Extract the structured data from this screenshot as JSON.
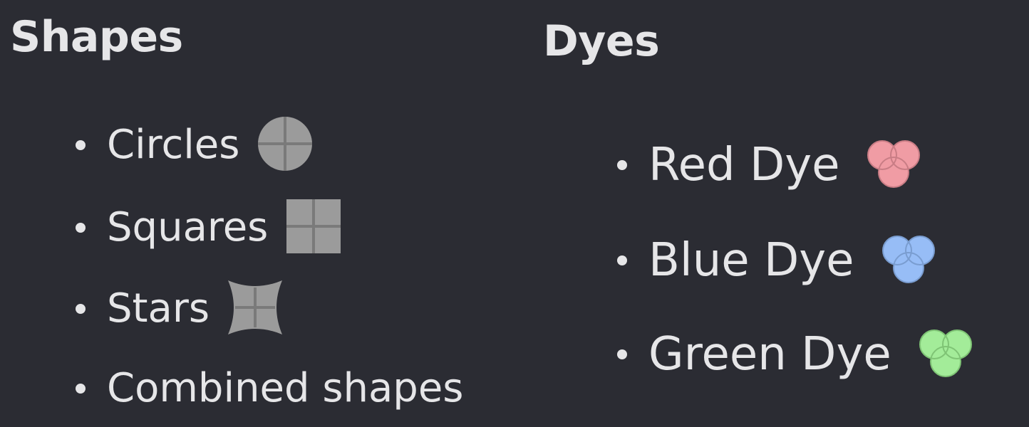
{
  "shapes": {
    "title": "Shapes",
    "items": [
      {
        "label": "Circles",
        "icon": "circle-icon"
      },
      {
        "label": "Squares",
        "icon": "square-icon"
      },
      {
        "label": "Stars",
        "icon": "star-icon"
      },
      {
        "label": "Combined shapes",
        "icon": ""
      }
    ]
  },
  "dyes": {
    "title": "Dyes",
    "items": [
      {
        "label": "Red Dye",
        "icon": "red-dye-icon",
        "color": "#f09ca4"
      },
      {
        "label": "Blue Dye",
        "icon": "blue-dye-icon",
        "color": "#97bdf6"
      },
      {
        "label": "Green Dye",
        "icon": "green-dye-icon",
        "color": "#a3ec99"
      }
    ]
  },
  "colors": {
    "background": "#2b2c33",
    "text": "#e6e6e8",
    "shape_icon": "#9b9b9b"
  }
}
